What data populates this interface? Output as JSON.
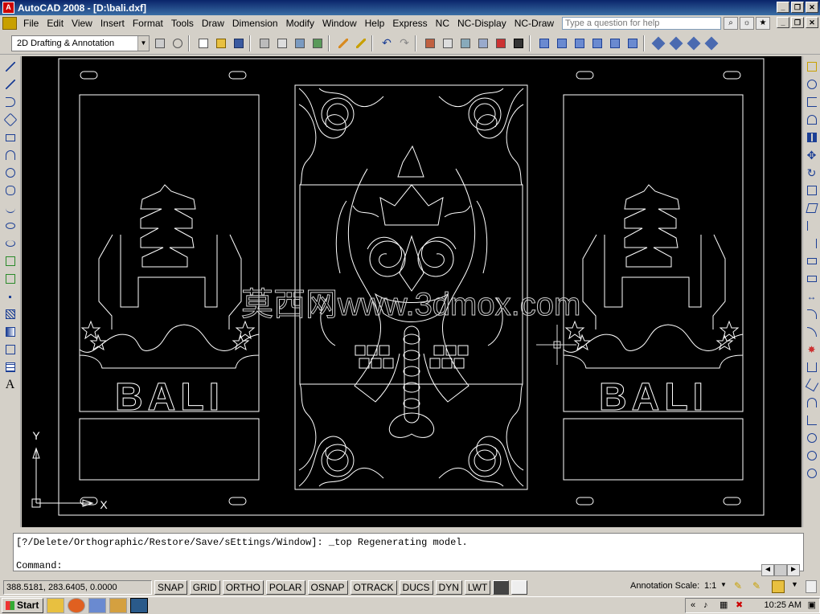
{
  "window": {
    "title": "AutoCAD 2008 - [D:\\bali.dxf]",
    "app_icon": "autocad-icon"
  },
  "menu": {
    "items": [
      "File",
      "Edit",
      "View",
      "Insert",
      "Format",
      "Tools",
      "Draw",
      "Dimension",
      "Modify",
      "Window",
      "Help",
      "Express",
      "NC",
      "NC-Display",
      "NC-Draw"
    ]
  },
  "help": {
    "placeholder": "Type a question for help"
  },
  "toolbar": {
    "workspace": "2D Drafting & Annotation"
  },
  "drawing": {
    "left_panel_text": "BALI",
    "right_panel_text": "BALI",
    "watermark": "莫西网www.3dmox.com",
    "axis_y": "Y",
    "axis_x": "X"
  },
  "command": {
    "history": "[?/Delete/Orthographic/Restore/Save/sEttings/Window]: _top Regenerating model.",
    "prompt": "Command:"
  },
  "status": {
    "coords": "388.5181, 283.6405, 0.0000",
    "toggles": [
      "SNAP",
      "GRID",
      "ORTHO",
      "POLAR",
      "OSNAP",
      "OTRACK",
      "DUCS",
      "DYN",
      "LWT"
    ],
    "annotation_scale_label": "Annotation Scale:",
    "annotation_scale_value": "1:1"
  },
  "taskbar": {
    "start": "Start",
    "clock": "10:25 AM"
  },
  "colors": {
    "title": "#0a246a",
    "canvas": "#000000",
    "lines": "#ffffff"
  }
}
